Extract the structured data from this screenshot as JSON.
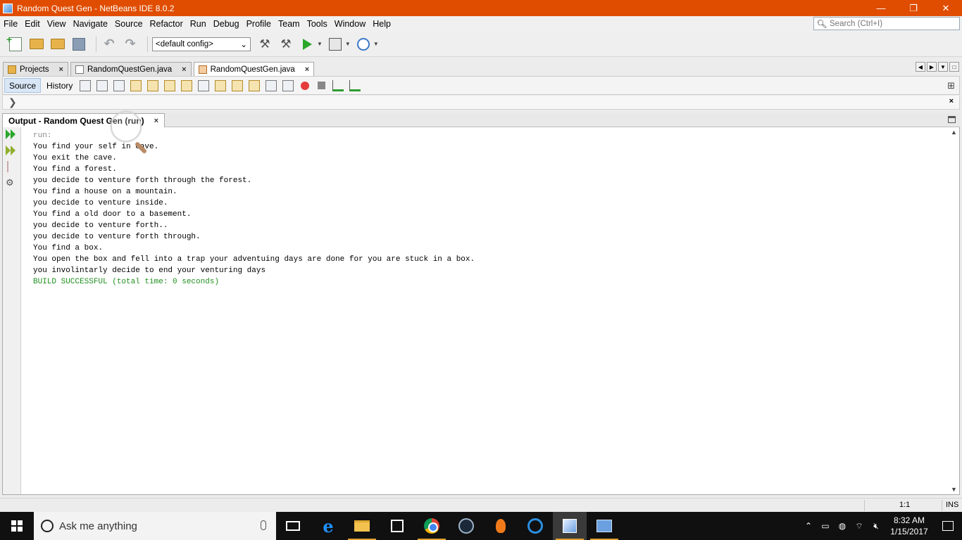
{
  "window": {
    "title": "Random Quest Gen - NetBeans IDE 8.0.2",
    "controls": [
      "—",
      "❐",
      "✕"
    ]
  },
  "menu": [
    "File",
    "Edit",
    "View",
    "Navigate",
    "Source",
    "Refactor",
    "Run",
    "Debug",
    "Profile",
    "Team",
    "Tools",
    "Window",
    "Help"
  ],
  "search": {
    "placeholder": "Search (Ctrl+I)"
  },
  "toolbar": {
    "config": "<default config>"
  },
  "tabs": [
    {
      "label": "Projects"
    },
    {
      "label": "RandomQuestGen.java"
    },
    {
      "label": "RandomQuestGen.java"
    }
  ],
  "editor": {
    "source_label": "Source",
    "history_label": "History"
  },
  "output": {
    "tab_label": "Output - Random Quest Gen (run)",
    "lines": [
      "run:",
      "You find your self in cave.",
      "You exit the cave.",
      "You find a forest.",
      "you decide to venture forth through the forest.",
      "You find a house on a mountain.",
      "you decide to venture inside.",
      "You find a old door to a basement.",
      "you decide to venture forth..",
      "you decide to venture forth through.",
      "You find a box.",
      "You open the box and fell into a trap your adventuing days are done for you are stuck in a box.",
      "you involintarly decide to end your venturing days",
      "BUILD SUCCESSFUL (total time: 0 seconds)"
    ]
  },
  "status": {
    "position": "1:1",
    "mode": "INS"
  },
  "taskbar": {
    "search_text": "Ask me anything",
    "time": "8:32 AM",
    "date": "1/15/2017"
  }
}
